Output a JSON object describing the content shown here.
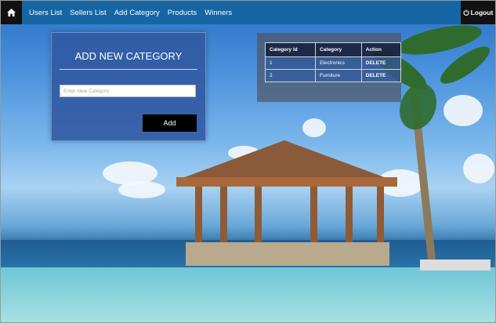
{
  "nav": {
    "items": [
      {
        "label": "Users List"
      },
      {
        "label": "Sellers List"
      },
      {
        "label": "Add Category"
      },
      {
        "label": "Products"
      },
      {
        "label": "Winners"
      }
    ],
    "logout_label": "Logout",
    "home_icon": "home-icon",
    "logout_icon": "power-icon",
    "bar_color": "#1566a3"
  },
  "add_panel": {
    "title": "ADD NEW CATEGORY",
    "input_placeholder": "Enter New Category",
    "input_value": "",
    "button_label": "Add"
  },
  "category_table": {
    "headers": [
      "Category Id",
      "Category",
      "Action"
    ],
    "rows": [
      {
        "id": "1",
        "name": "Electronics",
        "action": "DELETE"
      },
      {
        "id": "2",
        "name": "Furniture",
        "action": "DELETE"
      }
    ]
  }
}
